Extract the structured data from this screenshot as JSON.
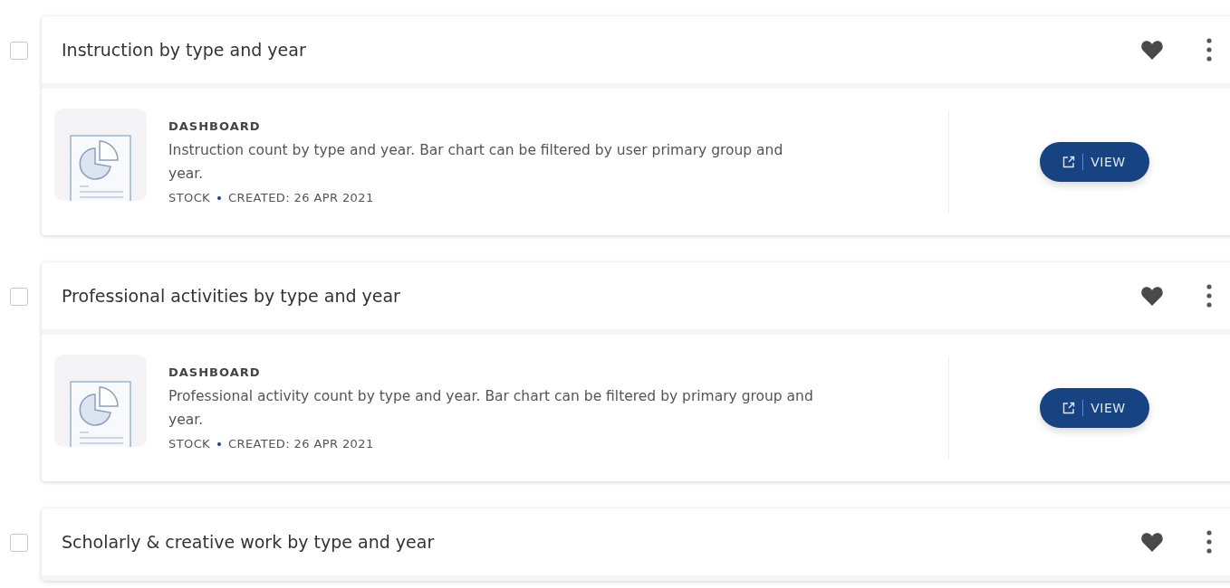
{
  "items": [
    {
      "title": "Instruction by type and year",
      "checked": false,
      "type": "DASHBOARD",
      "description": "Instruction count by type and year. Bar chart can be filtered by user primary group and year.",
      "source": "STOCK",
      "created": "CREATED: 26 APR 2021",
      "action": "VIEW"
    },
    {
      "title": "Professional activities by type and year",
      "checked": false,
      "type": "DASHBOARD",
      "description": "Professional activity count by type and year. Bar chart can be filtered by primary group and year.",
      "source": "STOCK",
      "created": "CREATED: 26 APR 2021",
      "action": "VIEW"
    },
    {
      "title": "Scholarly & creative work by type and year",
      "checked": false
    }
  ]
}
